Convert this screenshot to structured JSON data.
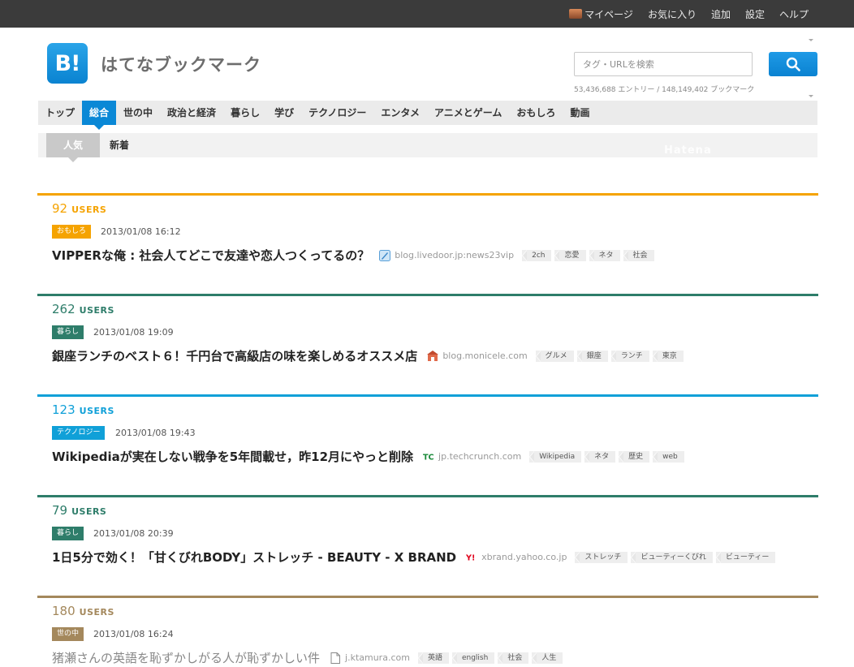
{
  "topnav": {
    "items": [
      "マイページ",
      "お気に入り",
      "追加",
      "設定",
      "ヘルプ"
    ]
  },
  "header": {
    "logo_text": "B!",
    "brand": "はてなブックマーク",
    "search_placeholder": "タグ・URLを検索",
    "stats": "53,436,688 エントリー / 148,149,402 ブックマーク"
  },
  "categories": [
    "トップ",
    "総合",
    "世の中",
    "政治と経済",
    "暮らし",
    "学び",
    "テクノロジー",
    "エンタメ",
    "アニメとゲーム",
    "おもしろ",
    "動画"
  ],
  "active_category": "総合",
  "subnav": [
    "人気",
    "新着"
  ],
  "active_subnav": "人気",
  "watermark": "Hatena",
  "users_unit": "USERS",
  "colors": {
    "accent": "#0a88d6",
    "omoshiro": "#f5a300",
    "kurashi": "#2e7d6a",
    "technology": "#10a0d8",
    "yononaka": "#a4885c"
  },
  "entries": [
    {
      "users": "92",
      "category": "おもしろ",
      "color": "#f5a300",
      "date": "2013/01/08 16:12",
      "title": "VIPPERな俺 : 社会人てどこで友達や恋人つくってるの？",
      "favicon": "quill-icon",
      "domain": "blog.livedoor.jp:news23vip",
      "tags": [
        "2ch",
        "恋愛",
        "ネタ",
        "社会"
      ]
    },
    {
      "users": "262",
      "category": "暮らし",
      "color": "#2e7d6a",
      "date": "2013/01/08 19:09",
      "title": "銀座ランチのベスト６！千円台で高級店の味を楽しめるオススメ店",
      "favicon": "shop-icon",
      "domain": "blog.monicele.com",
      "tags": [
        "グルメ",
        "銀座",
        "ランチ",
        "東京"
      ]
    },
    {
      "users": "123",
      "category": "テクノロジー",
      "color": "#10a0d8",
      "date": "2013/01/08 19:43",
      "title": "Wikipediaが実在しない戦争を5年間載せ，昨12月にやっと削除",
      "favicon": "techcrunch-icon",
      "domain": "jp.techcrunch.com",
      "tags": [
        "Wikipedia",
        "ネタ",
        "歴史",
        "web"
      ]
    },
    {
      "users": "79",
      "category": "暮らし",
      "color": "#2e7d6a",
      "date": "2013/01/08 20:39",
      "title": "1日5分で効く！「甘くびれBODY」ストレッチ - BEAUTY - X BRAND",
      "favicon": "yahoo-icon",
      "domain": "xbrand.yahoo.co.jp",
      "tags": [
        "ストレッチ",
        "ビューティーくびれ",
        "ビューティー"
      ]
    },
    {
      "users": "180",
      "category": "世の中",
      "color": "#a4885c",
      "date": "2013/01/08 16:24",
      "title": "猪瀬さんの英語を恥ずかしがる人が恥ずかしい件",
      "favicon": "page-icon",
      "domain": "j.ktamura.com",
      "tags": [
        "英語",
        "english",
        "社会",
        "人生"
      ]
    }
  ]
}
